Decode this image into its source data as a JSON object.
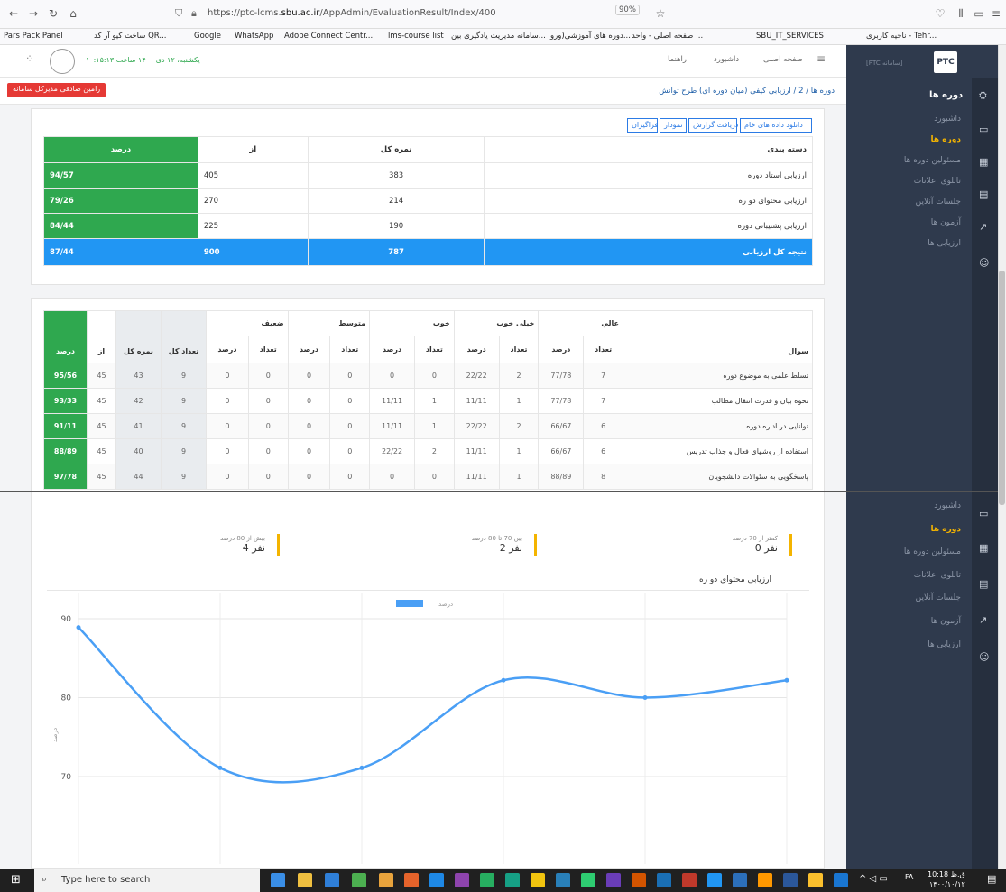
{
  "browser": {
    "url_prefix": "https://ptc-lcms.",
    "url_domain": "sbu.ac.ir",
    "url_path": "/AppAdmin/EvaluationResult/Index/400",
    "zoom": "90%",
    "bookmarks": [
      "Pars Pack Panel",
      "ساخت کیو آر کد QR...",
      "Google",
      "WhatsApp",
      "Adobe Connect Centr...",
      "lms-course list",
      "سامانه مدیریت یادگیری بین...",
      "دوره های آموزشی(ورو...",
      "صفحه اصلی - واحد ...",
      "SBU_IT_SERVICES",
      "ناحیه کاربری - Tehr..."
    ]
  },
  "header": {
    "datetime": "یکشنبه، ۱۲ دی ۱۴۰۰ ساعت ۱۰:۱۵:۱۳",
    "nav": [
      "صفحه اصلی",
      "داشبورد",
      "راهنما"
    ],
    "brand": "[PTC سامانه]",
    "admin_badge": "رامین صادقی مدیرکل سامانه"
  },
  "breadcrumb": {
    "root": "دوره ها",
    "sep": "/",
    "num": "2",
    "current": "ارزیابی کیفی (میان دوره ای) طرح توانش"
  },
  "sidebar": {
    "title": "دوره ها",
    "items": [
      "داشبورد",
      "دوره ها",
      "مسئولین دوره ها",
      "تابلوی اعلانات",
      "جلسات آنلاین",
      "آزمون ها",
      "ارزیابی ها"
    ]
  },
  "toolbar": {
    "buttons": [
      "دانلود داده های خام",
      "دریافت گزارش",
      "نمودار",
      "فراگیران"
    ]
  },
  "summary_table": {
    "headers": [
      "دسته بندی",
      "نمره کل",
      "از",
      "درصد"
    ],
    "rows": [
      [
        "ارزیابی استاد دوره",
        "383",
        "405",
        "94/57"
      ],
      [
        "ارزیابی محتوای دو ره",
        "214",
        "270",
        "79/26"
      ],
      [
        "ارزیابی پشتیبانی دوره",
        "190",
        "225",
        "84/44"
      ]
    ],
    "total": [
      "نتیجه کل ارزیابی",
      "787",
      "900",
      "87/44"
    ]
  },
  "detail_table": {
    "group_headers": [
      "عالي",
      "خیلی خوب",
      "خوب",
      "متوسط",
      "ضعیف"
    ],
    "sub_headers": [
      "تعداد",
      "درصد"
    ],
    "col_question": "سوال",
    "col_count_total": "تعداد کل",
    "col_score_total": "نمره کل",
    "col_of": "از",
    "col_percent": "درصد",
    "rows": [
      {
        "q": "تسلط علمی به موضوع دوره",
        "v": [
          "7",
          "77/78",
          "2",
          "22/22",
          "0",
          "0",
          "0",
          "0",
          "0",
          "0",
          "9",
          "43",
          "45",
          "95/56"
        ]
      },
      {
        "q": "نحوه بیان و قدرت انتقال مطالب",
        "v": [
          "7",
          "77/78",
          "1",
          "11/11",
          "1",
          "11/11",
          "0",
          "0",
          "0",
          "0",
          "9",
          "42",
          "45",
          "93/33"
        ]
      },
      {
        "q": "توانایی در اداره دوره",
        "v": [
          "6",
          "66/67",
          "2",
          "22/22",
          "1",
          "11/11",
          "0",
          "0",
          "0",
          "0",
          "9",
          "41",
          "45",
          "91/11"
        ]
      },
      {
        "q": "استفاده از روشهای فعال و جذاب تدریس",
        "v": [
          "6",
          "66/67",
          "1",
          "11/11",
          "2",
          "22/22",
          "0",
          "0",
          "0",
          "0",
          "9",
          "40",
          "45",
          "88/89"
        ]
      },
      {
        "q": "پاسخگویی به سئوالات دانشجویان",
        "v": [
          "8",
          "88/89",
          "1",
          "11/11",
          "0",
          "0",
          "0",
          "0",
          "0",
          "0",
          "9",
          "44",
          "45",
          "97/78"
        ]
      }
    ]
  },
  "stats": [
    {
      "label": "کمتر از 70 درصد",
      "value": "0 نفر"
    },
    {
      "label": "بین 70 تا 80 درصد",
      "value": "2 نفر"
    },
    {
      "label": "بیش از 80 درصد",
      "value": "4 نفر"
    }
  ],
  "section_title": "ارزیابی محتوای دو ره",
  "chart_data": {
    "type": "line",
    "legend": "درصد",
    "ylabel": "درصد",
    "ylim": [
      70,
      90
    ],
    "yticks": [
      70,
      80,
      90
    ],
    "x": [
      1,
      2,
      3,
      4,
      5,
      6
    ],
    "values": [
      88.9,
      71.1,
      71.1,
      82.2,
      80.0,
      82.2
    ],
    "color": "#4a9ff5",
    "legend_position": "top",
    "grid": true
  },
  "taskbar": {
    "search_placeholder": "Type here to search",
    "time": "10:18 ق.ظ",
    "date": "۱۴۰۰/۱۰/۱۲",
    "lang": "FA"
  }
}
